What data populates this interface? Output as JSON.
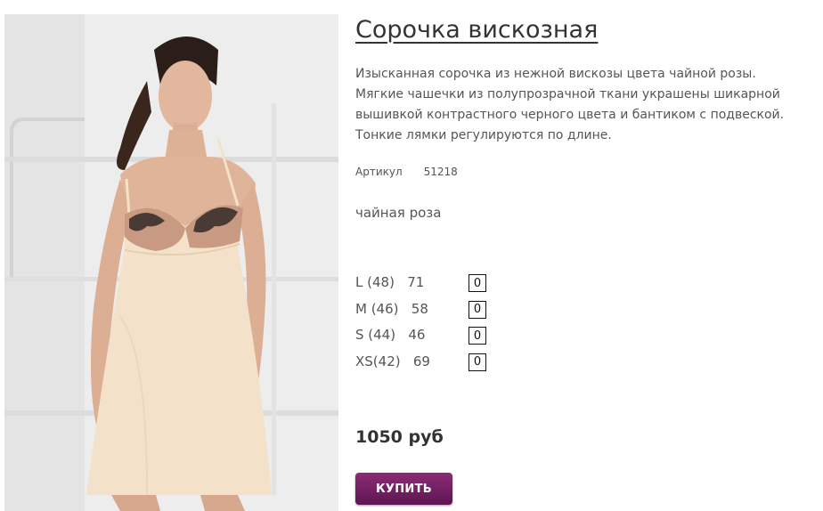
{
  "product": {
    "title": "Сорочка вискозная",
    "description": "Изысканная сорочка из нежной вискозы цвета чайной розы. Мягкие чашечки из полупрозрачной ткани украшены шикарной вышивкой контрастного черного цвета и бантиком с подвеской. Тонкие лямки регулируются по длине.",
    "article_label": "Артикул",
    "article_value": "51218",
    "color_name": "чайная роза",
    "sizes": [
      {
        "label": "L (48)   71",
        "qty": "0"
      },
      {
        "label": "M (46)   58",
        "qty": "0"
      },
      {
        "label": "S (44)   46",
        "qty": "0"
      },
      {
        "label": "XS(42)   69",
        "qty": "0"
      }
    ],
    "price": "1050 руб",
    "buy_label": "КУПИТЬ"
  },
  "colors": {
    "button_top": "#8b2d74",
    "button_bottom": "#5d1552",
    "gown": "#f3e2c9",
    "wall": "#ececec"
  }
}
